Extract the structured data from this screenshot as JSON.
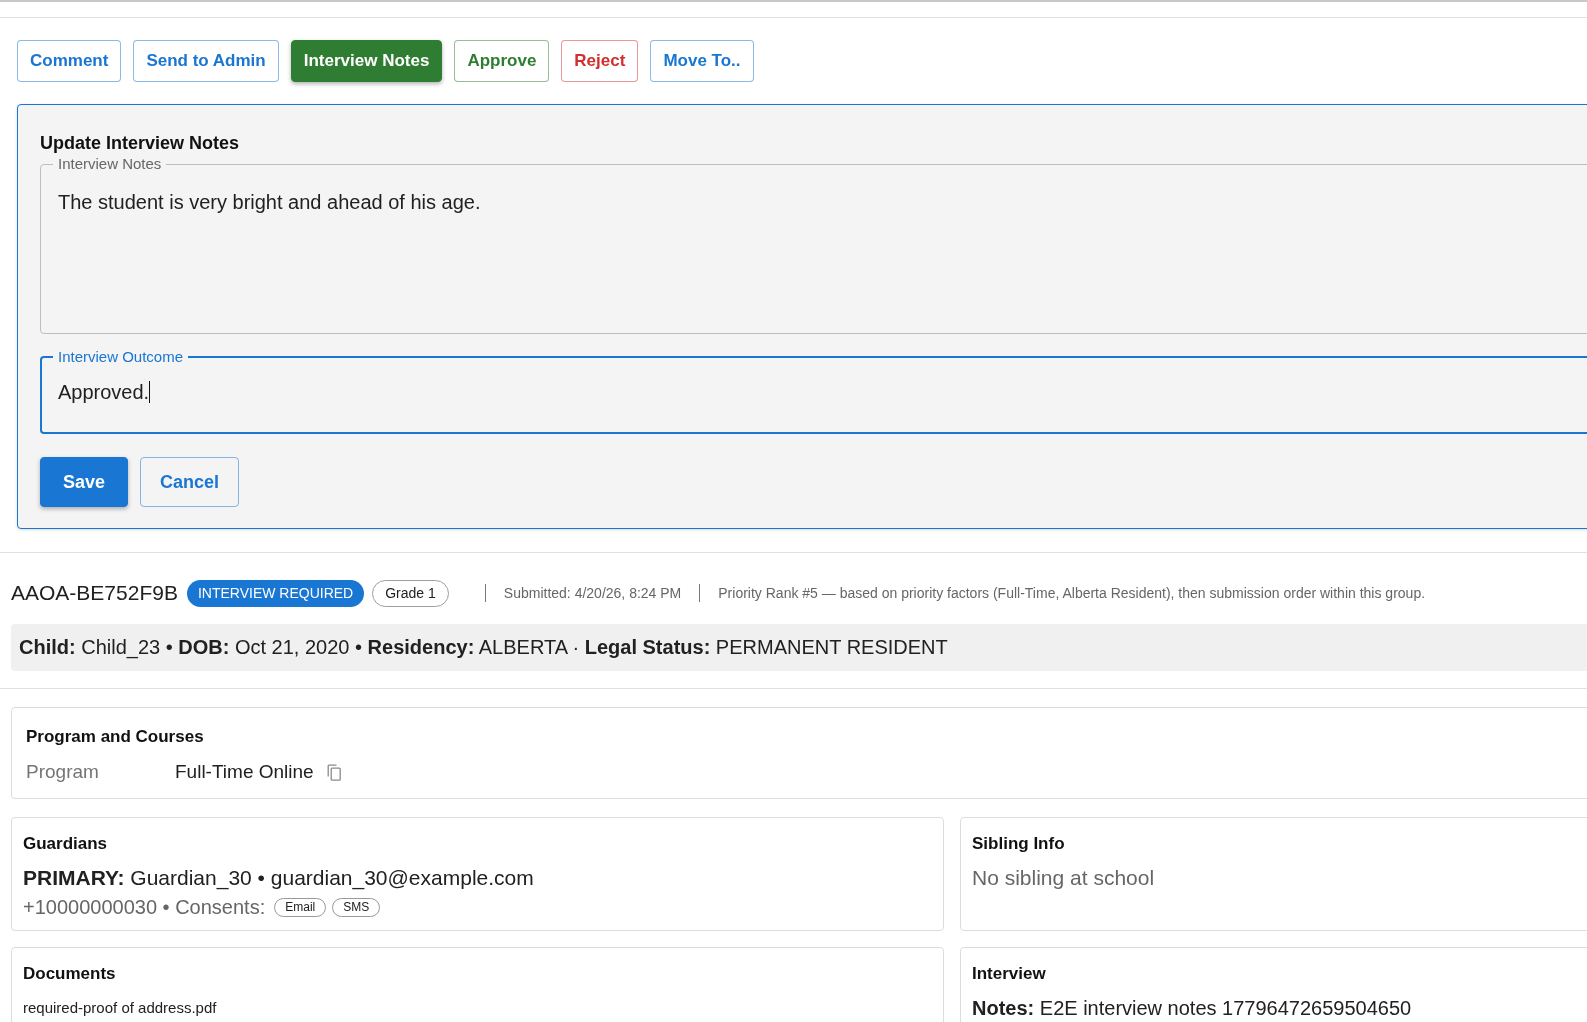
{
  "toolbar": {
    "buttons": [
      {
        "label": "Comment",
        "kind": "neutral",
        "selected": false
      },
      {
        "label": "Send to Admin",
        "kind": "neutral",
        "selected": false
      },
      {
        "label": "Interview Notes",
        "kind": "success",
        "selected": true
      },
      {
        "label": "Approve",
        "kind": "success",
        "selected": false
      },
      {
        "label": "Reject",
        "kind": "danger",
        "selected": false
      },
      {
        "label": "Move To..",
        "kind": "neutral",
        "selected": false
      }
    ]
  },
  "notes_panel": {
    "title": "Update Interview Notes",
    "fields": [
      {
        "kind": "textarea",
        "label": "Interview Notes",
        "value": "The student is very bright and ahead of his age.",
        "focused": false
      },
      {
        "kind": "input",
        "label": "Interview Outcome",
        "value": "Approved.",
        "focused": true
      }
    ],
    "buttons": [
      {
        "label": "Save",
        "kind": "primary"
      },
      {
        "label": "Cancel",
        "kind": "secondary"
      }
    ]
  },
  "application": {
    "id": "AAOA-BE752F9B",
    "status": "INTERVIEW REQUIRED",
    "grade": "Grade 1",
    "submitted": "Submitted: 4/20/26, 8:24 PM",
    "priority": "Priority Rank #5 — based on priority factors (Full-Time, Alberta Resident), then submission order within this group.",
    "summary": "**Child:** Child_23 • **DOB:** Oct 21, 2020 • **Residency:** ALBERTA · **Legal Status:** PERMANENT RESIDENT"
  },
  "program_card": {
    "title": "Program and Courses",
    "rows": [
      {
        "label": "Program",
        "value": "Full-Time Online"
      }
    ]
  },
  "guardians_card": {
    "title": "Guardians",
    "primary": "**PRIMARY:** Guardian_30 • guardian_30@example.com",
    "contact": "+10000000030 • Consents:",
    "consents": [
      "Email",
      "SMS"
    ]
  },
  "sibling_card": {
    "title": "Sibling Info",
    "text": "No sibling at school"
  },
  "documents_card": {
    "title": "Documents",
    "files": [
      "required-proof of address.pdf"
    ]
  },
  "interview_card": {
    "title": "Interview",
    "notes": "**Notes:** E2E interview notes 17796472659504650"
  }
}
